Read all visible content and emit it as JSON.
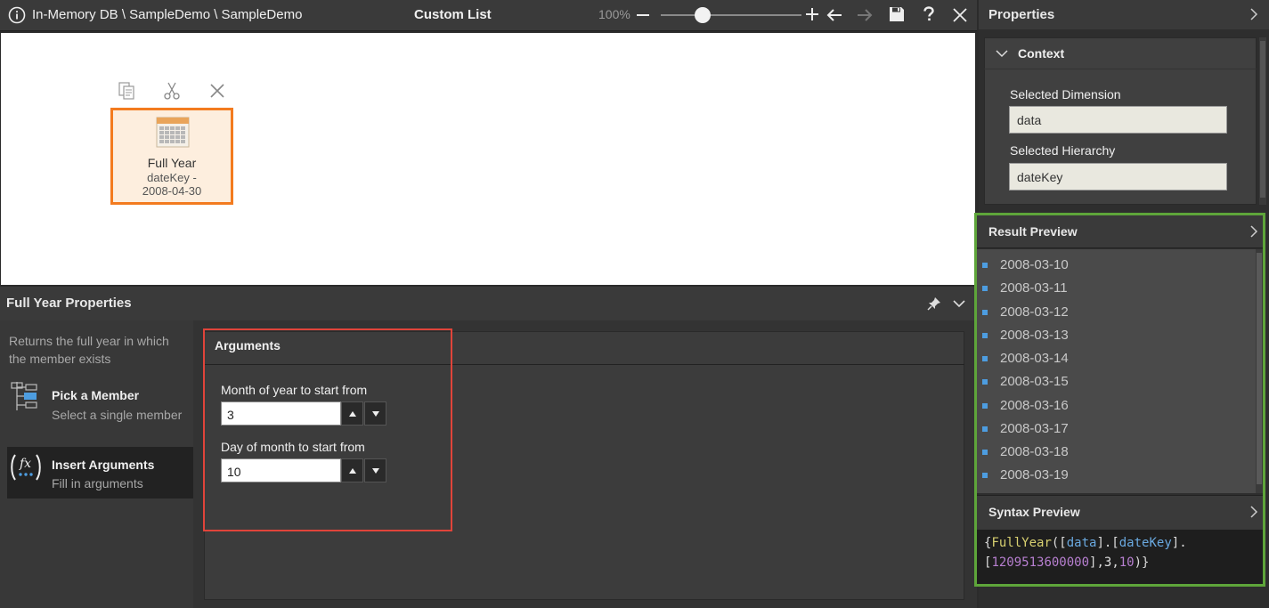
{
  "topbar": {
    "breadcrumb": "In-Memory DB \\ SampleDemo \\ SampleDemo",
    "title": "Custom List",
    "zoom": "100%"
  },
  "tile": {
    "title": "Full Year",
    "subtitle_line1": "dateKey -",
    "subtitle_line2": "2008-04-30"
  },
  "properties_panel": {
    "title": "Full Year Properties",
    "description": "Returns the full year in which the member exists",
    "nav": [
      {
        "label": "Pick a Member",
        "sub": "Select a single member"
      },
      {
        "label": "Insert Arguments",
        "sub": "Fill in arguments"
      }
    ],
    "arguments": {
      "title": "Arguments",
      "month_label": "Month of year to start from",
      "month_value": "3",
      "day_label": "Day of month to start from",
      "day_value": "10"
    }
  },
  "right_panel": {
    "title": "Properties",
    "context": {
      "title": "Context",
      "dimension_label": "Selected Dimension",
      "dimension_value": "data",
      "hierarchy_label": "Selected Hierarchy",
      "hierarchy_value": "dateKey"
    },
    "result_preview": {
      "title": "Result Preview",
      "items": [
        "2008-03-10",
        "2008-03-11",
        "2008-03-12",
        "2008-03-13",
        "2008-03-14",
        "2008-03-15",
        "2008-03-16",
        "2008-03-17",
        "2008-03-18",
        "2008-03-19"
      ]
    },
    "syntax_preview": {
      "title": "Syntax Preview",
      "line1": {
        "open": "{",
        "fn": "FullYear",
        "p1": "([",
        "dim": "data",
        "p2": "].[",
        "hier": "dateKey",
        "p3": "]."
      },
      "line2": {
        "p1": "[",
        "key": "1209513600000",
        "p2": "],",
        "a1": "3",
        "comma": ",",
        "a2": "10",
        "close": ")}"
      }
    }
  },
  "colors": {
    "tile_border": "#f37b1f",
    "highlight_red": "#e0443a",
    "highlight_green": "#5ea53a",
    "list_bullet": "#4d9de0"
  }
}
